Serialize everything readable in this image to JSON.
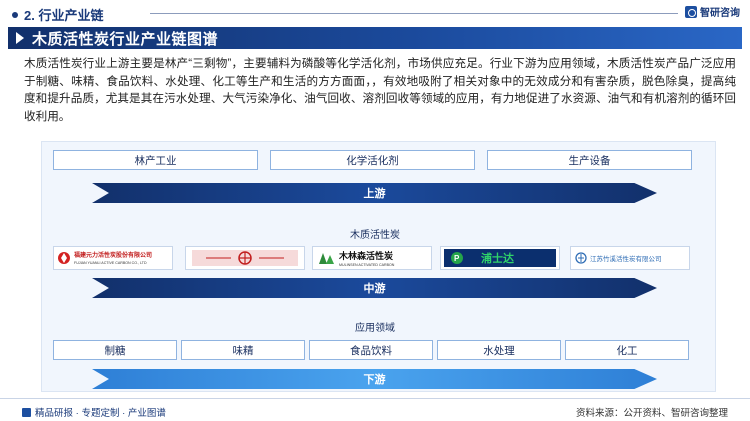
{
  "header": {
    "section_title": "2. 行业产业链",
    "brand": "智研咨询"
  },
  "title": "木质活性炭行业产业链图谱",
  "description": "木质活性炭行业上游主要是林产“三剩物”，主要辅料为磷酸等化学活化剂，市场供应充足。行业下游为应用领域，木质活性炭产品广泛应用于制糖、味精、食品饮料、水处理、化工等生产和生活的方方面面，，有效地吸附了相关对象中的无效成分和有害杂质，脱色除臭，提高纯度和提升品质，尤其是其在污水处理、大气污染净化、油气回收、溶剂回收等领域的应用，有力地促进了水资源、油气和有机溶剂的循环回收利用。",
  "upstream": {
    "items": [
      "林产工业",
      "化学活化剂",
      "生产设备"
    ],
    "label": "上游"
  },
  "midstream": {
    "heading": "木质活性炭",
    "companies": [
      {
        "cn": "福建元力活性炭股份有限公司",
        "en": "FUJIAN YUANLI ACTIVE CARBON CO., LTD"
      },
      {
        "cn": "",
        "en": ""
      },
      {
        "cn": "木林森活性炭",
        "en": "MULINSEN ACTIVATED CARBON"
      },
      {
        "cn": "浦士达",
        "en": ""
      },
      {
        "cn": "江苏竹溪活性炭有限公司",
        "en": ""
      }
    ],
    "label": "中游"
  },
  "downstream": {
    "heading": "应用领域",
    "items": [
      "制糖",
      "味精",
      "食品饮料",
      "水处理",
      "化工"
    ],
    "label": "下游"
  },
  "footer": {
    "left": "精品研报 · 专题定制 · 产业图谱",
    "right": "资料来源：公开资料、智研咨询整理"
  },
  "colors": {
    "navy": "#12306b",
    "blue": "#1b4a9c",
    "light_blue": "#3d8fe0",
    "panel_bg": "#f1f6fd"
  }
}
